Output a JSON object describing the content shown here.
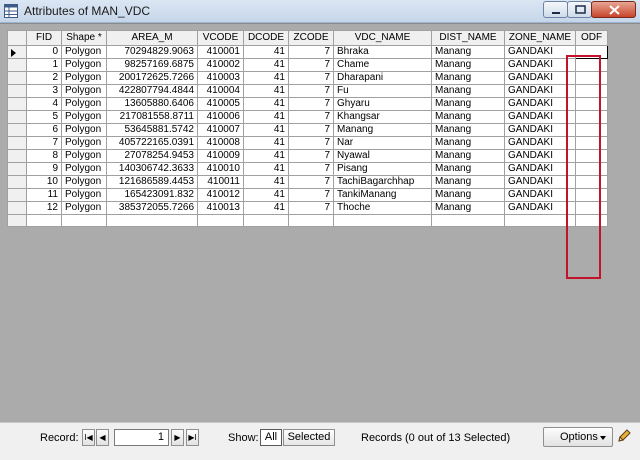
{
  "window": {
    "title": "Attributes of MAN_VDC"
  },
  "table": {
    "columns": [
      "FID",
      "Shape *",
      "AREA_M",
      "VCODE",
      "DCODE",
      "ZCODE",
      "VDC_NAME",
      "DIST_NAME",
      "ZONE_NAME",
      "ODF"
    ],
    "rows": [
      [
        "0",
        "Polygon",
        "70294829.9063",
        "410001",
        "41",
        "7",
        "Bhraka",
        "Manang",
        "GANDAKI",
        ""
      ],
      [
        "1",
        "Polygon",
        "98257169.6875",
        "410002",
        "41",
        "7",
        "Chame",
        "Manang",
        "GANDAKI",
        ""
      ],
      [
        "2",
        "Polygon",
        "200172625.7266",
        "410003",
        "41",
        "7",
        "Dharapani",
        "Manang",
        "GANDAKI",
        ""
      ],
      [
        "3",
        "Polygon",
        "422807794.4844",
        "410004",
        "41",
        "7",
        "Fu",
        "Manang",
        "GANDAKI",
        ""
      ],
      [
        "4",
        "Polygon",
        "13605880.6406",
        "410005",
        "41",
        "7",
        "Ghyaru",
        "Manang",
        "GANDAKI",
        ""
      ],
      [
        "5",
        "Polygon",
        "217081558.8711",
        "410006",
        "41",
        "7",
        "Khangsar",
        "Manang",
        "GANDAKI",
        ""
      ],
      [
        "6",
        "Polygon",
        "53645881.5742",
        "410007",
        "41",
        "7",
        "Manang",
        "Manang",
        "GANDAKI",
        ""
      ],
      [
        "7",
        "Polygon",
        "405722165.0391",
        "410008",
        "41",
        "7",
        "Nar",
        "Manang",
        "GANDAKI",
        ""
      ],
      [
        "8",
        "Polygon",
        "27078254.9453",
        "410009",
        "41",
        "7",
        "Nyawal",
        "Manang",
        "GANDAKI",
        ""
      ],
      [
        "9",
        "Polygon",
        "140306742.3633",
        "410010",
        "41",
        "7",
        "Pisang",
        "Manang",
        "GANDAKI",
        ""
      ],
      [
        "10",
        "Polygon",
        "121686589.4453",
        "410011",
        "41",
        "7",
        "TachiBagarchhap",
        "Manang",
        "GANDAKI",
        ""
      ],
      [
        "11",
        "Polygon",
        "165423091.832",
        "410012",
        "41",
        "7",
        "TankiManang",
        "Manang",
        "GANDAKI",
        ""
      ],
      [
        "12",
        "Polygon",
        "385372055.7266",
        "410013",
        "41",
        "7",
        "Thoche",
        "Manang",
        "GANDAKI",
        ""
      ]
    ]
  },
  "status": {
    "record_label": "Record:",
    "record_value": "1",
    "show_label": "Show:",
    "all_label": "All",
    "selected_label": "Selected",
    "records_text": "Records (0 out of 13 Selected)",
    "options_label": "Options",
    "nav_first": "I◀",
    "nav_prev": "◀",
    "nav_next": "▶",
    "nav_last": "▶I"
  },
  "colors": {
    "highlight": "#c4122a"
  }
}
